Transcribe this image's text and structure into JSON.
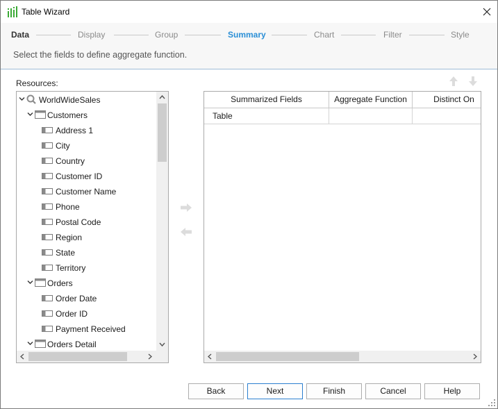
{
  "window": {
    "title": "Table Wizard",
    "close_symbol": "✕"
  },
  "steps": [
    {
      "label": "Data",
      "state": "done"
    },
    {
      "label": "Display",
      "state": "pending"
    },
    {
      "label": "Group",
      "state": "pending"
    },
    {
      "label": "Summary",
      "state": "active"
    },
    {
      "label": "Chart",
      "state": "pending"
    },
    {
      "label": "Filter",
      "state": "pending"
    },
    {
      "label": "Style",
      "state": "pending"
    }
  ],
  "subtitle": "Select the fields to define aggregate function.",
  "resources": {
    "label": "Resources:",
    "tree": [
      {
        "label": "WorldWideSales",
        "type": "query",
        "expanded": true
      },
      {
        "label": "Customers",
        "type": "table",
        "expanded": true
      },
      {
        "label": "Address 1",
        "type": "field"
      },
      {
        "label": "City",
        "type": "field"
      },
      {
        "label": "Country",
        "type": "field"
      },
      {
        "label": "Customer ID",
        "type": "field"
      },
      {
        "label": "Customer Name",
        "type": "field"
      },
      {
        "label": "Phone",
        "type": "field"
      },
      {
        "label": "Postal Code",
        "type": "field"
      },
      {
        "label": "Region",
        "type": "field"
      },
      {
        "label": "State",
        "type": "field"
      },
      {
        "label": "Territory",
        "type": "field"
      },
      {
        "label": "Orders",
        "type": "table",
        "expanded": true
      },
      {
        "label": "Order Date",
        "type": "field"
      },
      {
        "label": "Order ID",
        "type": "field"
      },
      {
        "label": "Payment Received",
        "type": "field"
      },
      {
        "label": "Orders Detail",
        "type": "table",
        "expanded": true
      }
    ]
  },
  "summary_grid": {
    "columns": [
      "Summarized Fields",
      "Aggregate Function",
      "Distinct On"
    ],
    "rows": [
      [
        "Table",
        "",
        ""
      ]
    ]
  },
  "buttons": {
    "back": "Back",
    "next": "Next",
    "finish": "Finish",
    "cancel": "Cancel",
    "help": "Help"
  },
  "colors": {
    "active_step": "#2b8fd6",
    "primary_border": "#2b7fd0"
  }
}
